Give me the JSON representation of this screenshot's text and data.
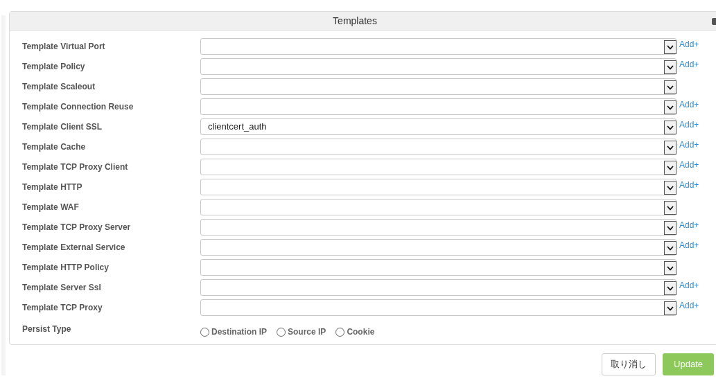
{
  "panel": {
    "title": "Templates",
    "rows": [
      {
        "label": "Template Virtual Port",
        "value": "",
        "add_link": "Add+"
      },
      {
        "label": "Template Policy",
        "value": "",
        "add_link": "Add+"
      },
      {
        "label": "Template Scaleout",
        "value": ""
      },
      {
        "label": "Template Connection Reuse",
        "value": "",
        "add_link": "Add+"
      },
      {
        "label": "Template Client SSL",
        "value": "clientcert_auth",
        "add_link": "Add+"
      },
      {
        "label": "Template Cache",
        "value": "",
        "add_link": "Add+"
      },
      {
        "label": "Template TCP Proxy Client",
        "value": "",
        "add_link": "Add+"
      },
      {
        "label": "Template HTTP",
        "value": "",
        "add_link": "Add+"
      },
      {
        "label": "Template WAF",
        "value": ""
      },
      {
        "label": "Template TCP Proxy Server",
        "value": "",
        "add_link": "Add+"
      },
      {
        "label": "Template External Service",
        "value": "",
        "add_link": "Add+"
      },
      {
        "label": "Template HTTP Policy",
        "value": ""
      },
      {
        "label": "Template Server Ssl",
        "value": "",
        "add_link": "Add+"
      },
      {
        "label": "Template TCP Proxy",
        "value": "",
        "add_link": "Add+"
      }
    ],
    "persist": {
      "label": "Persist Type",
      "options": [
        {
          "label": "Destination IP",
          "selected": false
        },
        {
          "label": "Source IP",
          "selected": false
        },
        {
          "label": "Cookie",
          "selected": false
        }
      ]
    }
  },
  "buttons": [
    {
      "label": "取り消し",
      "kind": "secondary"
    },
    {
      "label": "Update",
      "kind": "primary"
    }
  ]
}
